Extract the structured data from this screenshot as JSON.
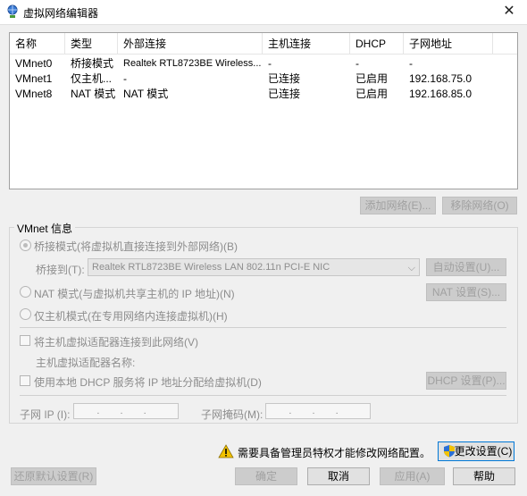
{
  "window": {
    "title": "虚拟网络编辑器",
    "close_glyph": "✕"
  },
  "table": {
    "headers": [
      "名称",
      "类型",
      "外部连接",
      "主机连接",
      "DHCP",
      "子网地址"
    ],
    "rows": [
      [
        "VMnet0",
        "桥接模式",
        "Realtek RTL8723BE Wireless...",
        "-",
        "-",
        "-"
      ],
      [
        "VMnet1",
        "仅主机...",
        "-",
        "已连接",
        "已启用",
        "192.168.75.0"
      ],
      [
        "VMnet8",
        "NAT 模式",
        "NAT 模式",
        "已连接",
        "已启用",
        "192.168.85.0"
      ]
    ]
  },
  "buttons": {
    "add_network": "添加网络(E)...",
    "remove_network": "移除网络(O)",
    "auto_settings": "自动设置(U)...",
    "nat_settings": "NAT 设置(S)...",
    "dhcp_settings": "DHCP 设置(P)...",
    "change_settings": "更改设置(C)",
    "restore_defaults": "还原默认设置(R)",
    "ok": "确定",
    "cancel": "取消",
    "apply": "应用(A)",
    "help": "帮助"
  },
  "vmnet_info": {
    "group_label": "VMnet 信息",
    "bridge_mode": "桥接模式(将虚拟机直接连接到外部网络)(B)",
    "bridge_to_label": "桥接到(T):",
    "bridge_to_value": "Realtek RTL8723BE Wireless LAN 802.11n PCI-E NIC",
    "nat_mode": "NAT 模式(与虚拟机共享主机的 IP 地址)(N)",
    "host_only_mode": "仅主机模式(在专用网络内连接虚拟机)(H)",
    "connect_adapter": "将主机虚拟适配器连接到此网络(V)",
    "adapter_name_label": "主机虚拟适配器名称:",
    "use_dhcp": "使用本地 DHCP 服务将 IP 地址分配给虚拟机(D)",
    "subnet_ip_label": "子网 IP (I):",
    "subnet_mask_label": "子网掩码(M):",
    "ip_placeholder": ". . ."
  },
  "warning_text": "需要具备管理员特权才能修改网络配置。",
  "colors": {
    "accent": "#0078d7",
    "warning": "#f2c200"
  }
}
